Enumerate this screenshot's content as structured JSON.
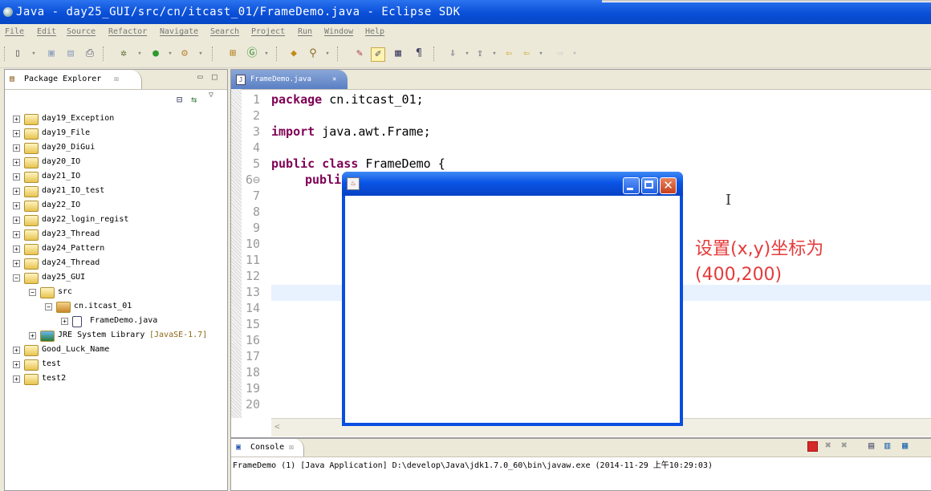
{
  "window": {
    "title": "Java - day25_GUI/src/cn/itcast_01/FrameDemo.java - Eclipse SDK"
  },
  "menubar": [
    "File",
    "Edit",
    "Source",
    "Refactor",
    "Navigate",
    "Search",
    "Project",
    "Run",
    "Window",
    "Help"
  ],
  "package_explorer": {
    "title": "Package Explorer",
    "tab_close": "☒",
    "tree": [
      {
        "label": "day19_Exception",
        "level": 0,
        "expanded": false
      },
      {
        "label": "day19_File",
        "level": 0,
        "expanded": false
      },
      {
        "label": "day20_DiGui",
        "level": 0,
        "expanded": false
      },
      {
        "label": "day20_IO",
        "level": 0,
        "expanded": false
      },
      {
        "label": "day21_IO",
        "level": 0,
        "expanded": false
      },
      {
        "label": "day21_IO_test",
        "level": 0,
        "expanded": false
      },
      {
        "label": "day22_IO",
        "level": 0,
        "expanded": false
      },
      {
        "label": "day22_login_regist",
        "level": 0,
        "expanded": false
      },
      {
        "label": "day23_Thread",
        "level": 0,
        "expanded": false
      },
      {
        "label": "day24_Pattern",
        "level": 0,
        "expanded": false
      },
      {
        "label": "day24_Thread",
        "level": 0,
        "expanded": false
      },
      {
        "label": "day25_GUI",
        "level": 0,
        "expanded": true
      },
      {
        "label": "src",
        "level": 1,
        "expanded": true
      },
      {
        "label": "cn.itcast_01",
        "level": 2,
        "expanded": true
      },
      {
        "label": "FrameDemo.java",
        "level": 3,
        "expanded": false
      },
      {
        "label": "JRE System Library",
        "extra": "[JavaSE-1.7]",
        "level": 1,
        "expanded": false
      },
      {
        "label": "Good_Luck_Name",
        "level": 0,
        "expanded": false
      },
      {
        "label": "test",
        "level": 0,
        "expanded": false
      },
      {
        "label": "test2",
        "level": 0,
        "expanded": false
      }
    ]
  },
  "editor": {
    "tab_label": "FrameDemo.java",
    "tab_close": "✕",
    "line_numbers": [
      "1",
      "2",
      "3",
      "4",
      "5",
      "6⊖",
      "7",
      "8",
      "9",
      "10",
      "11",
      "12",
      "13",
      "14",
      "15",
      "16",
      "17",
      "18",
      "19",
      "20"
    ],
    "lines": {
      "l1_kw": "package",
      "l1_rest": " cn.itcast_01;",
      "l3_kw": "import",
      "l3_rest": " java.awt.Frame;",
      "l5_kw": "public class",
      "l5_rest": " FrameDemo {",
      "l6_text": "publi"
    }
  },
  "console": {
    "title": "Console",
    "tab_close": "☒",
    "status": "FrameDemo (1) [Java Application] D:\\develop\\Java\\jdk1.7.0_60\\bin\\javaw.exe (2014-11-29 上午10:29:03)"
  },
  "java_frame": {
    "title": ""
  },
  "annotation": {
    "line1": "设置(x,y)坐标为",
    "line2": "(400,200)"
  },
  "colors": {
    "annotation": "#e53b3b",
    "keyword": "#7f0055",
    "titlebar": "#0a4fd8"
  }
}
